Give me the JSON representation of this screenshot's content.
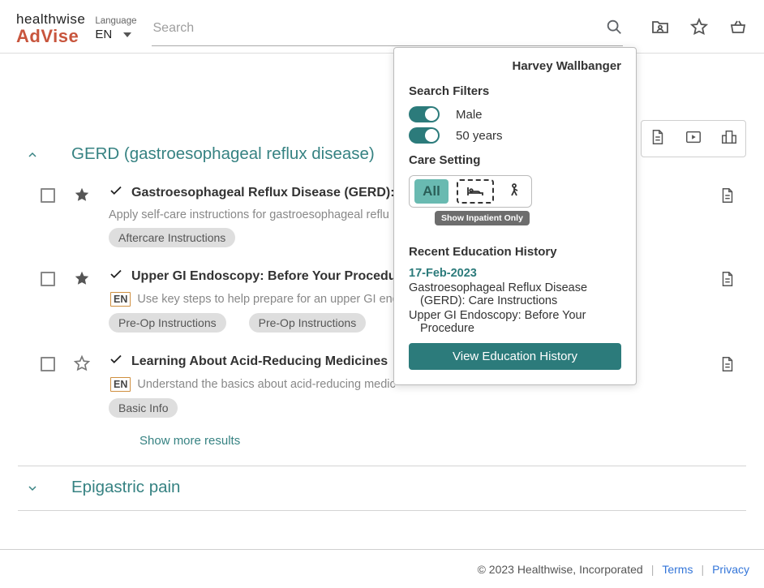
{
  "app": {
    "logo_top": "healthwise",
    "logo_bot": "AdVise"
  },
  "language": {
    "label": "Language",
    "value": "EN"
  },
  "search": {
    "placeholder": "Search"
  },
  "sections": [
    {
      "title": "GERD (gastroesophageal reflux disease)",
      "expanded": true,
      "show_more": "Show more results"
    },
    {
      "title": "Epigastric pain",
      "expanded": false
    }
  ],
  "results": [
    {
      "title": "Gastroesophageal Reflux Disease (GERD):",
      "title_trunc": true,
      "desc": "Apply self-care instructions for gastroesophageal reflu",
      "lang_badge": "",
      "tags": [
        "Aftercare Instructions"
      ],
      "starred": true
    },
    {
      "title": "Upper GI Endoscopy: Before Your Procedure",
      "title_trunc": true,
      "desc": "Use key steps to help prepare for an upper GI end",
      "lang_badge": "EN",
      "tags": [
        "Pre-Op Instructions",
        "Pre-Op Instructions"
      ],
      "starred": true
    },
    {
      "title": "Learning About Acid-Reducing Medicines",
      "title_trunc": false,
      "desc": "Understand the basics about acid-reducing medic",
      "lang_badge": "EN",
      "tags": [
        "Basic Info"
      ],
      "starred": false
    }
  ],
  "panel": {
    "user": "Harvey Wallbanger",
    "filters_header": "Search Filters",
    "sex_label": "Male",
    "age_label": "50 years",
    "care_setting_header": "Care Setting",
    "seg_all": "All",
    "tooltip": "Show Inpatient Only",
    "recent_header": "Recent Education History",
    "recent_date": "17-Feb-2023",
    "recent1_a": "Gastroesophageal Reflux Disease",
    "recent1_b": "(GERD): Care Instructions",
    "recent2_a": "Upper GI Endoscopy: Before Your",
    "recent2_b": "Procedure",
    "view_btn": "View Education History"
  },
  "footer": {
    "copyright": "© 2023 Healthwise, Incorporated",
    "terms": "Terms",
    "privacy": "Privacy"
  }
}
